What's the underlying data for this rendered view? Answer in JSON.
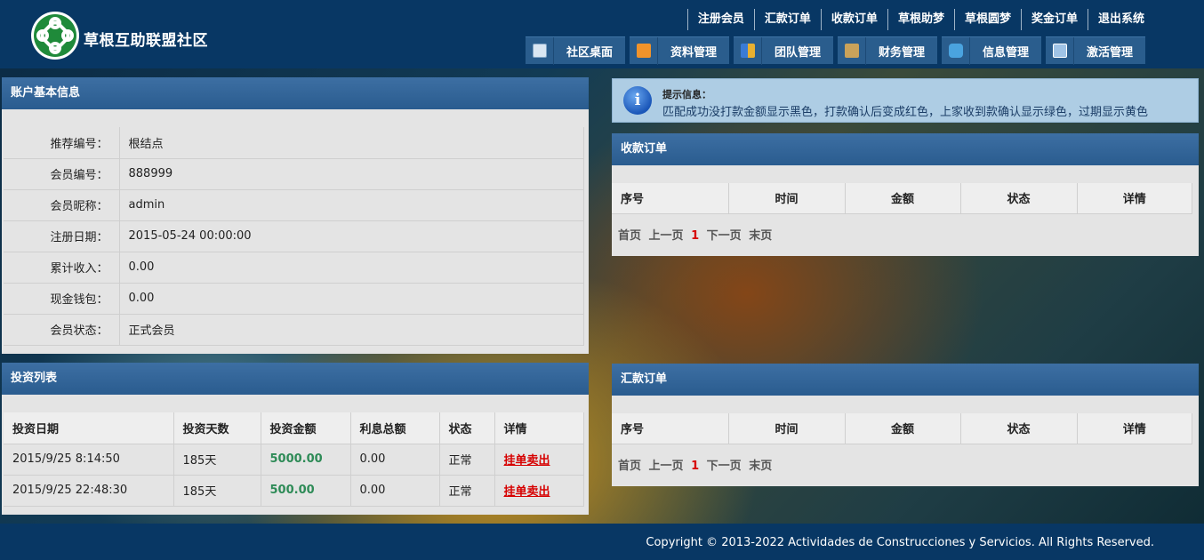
{
  "header": {
    "site_title": "草根互助联盟社区",
    "top_nav": [
      "注册会员",
      "汇款订单",
      "收款订单",
      "草根助梦",
      "草根圆梦",
      "奖金订单",
      "退出系统"
    ],
    "main_nav": [
      {
        "label": "社区桌面",
        "icon": "user-desktop-icon",
        "color": "#d9e6f2"
      },
      {
        "label": "资料管理",
        "icon": "folder-icon",
        "color": "#f0932b"
      },
      {
        "label": "团队管理",
        "icon": "team-icon",
        "color": "#e8b030"
      },
      {
        "label": "财务管理",
        "icon": "finance-icon",
        "color": "#c9a25a"
      },
      {
        "label": "信息管理",
        "icon": "message-icon",
        "color": "#4aa3df"
      },
      {
        "label": "激活管理",
        "icon": "activate-icon",
        "color": "#9fc3e6"
      }
    ]
  },
  "account": {
    "title": "账户基本信息",
    "rows": [
      {
        "label": "推荐编号：",
        "value": "根结点"
      },
      {
        "label": "会员编号：",
        "value": "888999"
      },
      {
        "label": "会员昵称：",
        "value": "admin"
      },
      {
        "label": "注册日期：",
        "value": "2015-05-24 00:00:00"
      },
      {
        "label": "累计收入：",
        "value": "0.00"
      },
      {
        "label": "现金钱包：",
        "value": "0.00"
      },
      {
        "label": "会员状态：",
        "value": "正式会员"
      }
    ]
  },
  "investments": {
    "title": "投资列表",
    "columns": [
      "投资日期",
      "投资天数",
      "投资金额",
      "利息总额",
      "状态",
      "详情"
    ],
    "rows": [
      {
        "date": "2015/9/25 8:14:50",
        "days": "185天",
        "amount": "5000.00",
        "interest": "0.00",
        "status": "正常",
        "action": "挂单卖出"
      },
      {
        "date": "2015/9/25 22:48:30",
        "days": "185天",
        "amount": "500.00",
        "interest": "0.00",
        "status": "正常",
        "action": "挂单卖出"
      }
    ]
  },
  "notice": {
    "title": "提示信息：",
    "text": "匹配成功没打款金额显示黑色，打款确认后变成红色，上家收到款确认显示绿色，过期显示黄色"
  },
  "receive_orders": {
    "title": "收款订单",
    "columns": [
      "序号",
      "时间",
      "金额",
      "状态",
      "详情"
    ],
    "pager": {
      "first": "首页",
      "prev": "上一页",
      "current": "1",
      "next": "下一页",
      "last": "末页"
    }
  },
  "remit_orders": {
    "title": "汇款订单",
    "columns": [
      "序号",
      "时间",
      "金额",
      "状态",
      "详情"
    ],
    "pager": {
      "first": "首页",
      "prev": "上一页",
      "current": "1",
      "next": "下一页",
      "last": "末页"
    }
  },
  "footer": {
    "copyright": "Copyright © 2013-2022 Actividades de Construcciones y Servicios. All Rights Reserved."
  }
}
